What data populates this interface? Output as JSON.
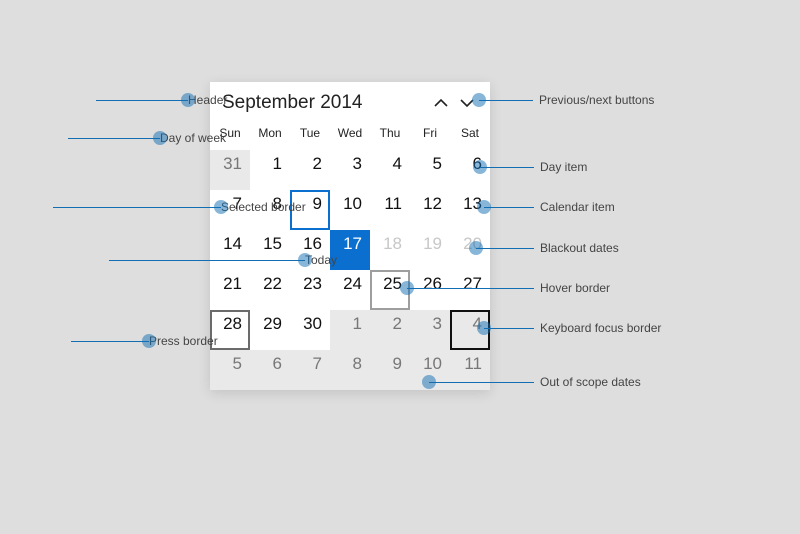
{
  "header": {
    "title": "September 2014"
  },
  "dow": [
    "Sun",
    "Mon",
    "Tue",
    "Wed",
    "Thu",
    "Fri",
    "Sat"
  ],
  "weeks": [
    [
      {
        "d": "31",
        "cls": "out"
      },
      {
        "d": "1"
      },
      {
        "d": "2"
      },
      {
        "d": "3"
      },
      {
        "d": "4"
      },
      {
        "d": "5"
      },
      {
        "d": "6"
      }
    ],
    [
      {
        "d": "7"
      },
      {
        "d": "8"
      },
      {
        "d": "9",
        "cls": "selected"
      },
      {
        "d": "10"
      },
      {
        "d": "11"
      },
      {
        "d": "12"
      },
      {
        "d": "13"
      }
    ],
    [
      {
        "d": "14"
      },
      {
        "d": "15"
      },
      {
        "d": "16"
      },
      {
        "d": "17",
        "cls": "today"
      },
      {
        "d": "18",
        "cls": "blackout"
      },
      {
        "d": "19",
        "cls": "blackout"
      },
      {
        "d": "20",
        "cls": "blackout"
      }
    ],
    [
      {
        "d": "21"
      },
      {
        "d": "22"
      },
      {
        "d": "23"
      },
      {
        "d": "24"
      },
      {
        "d": "25",
        "cls": "hover"
      },
      {
        "d": "26"
      },
      {
        "d": "27"
      }
    ],
    [
      {
        "d": "28",
        "cls": "press"
      },
      {
        "d": "29"
      },
      {
        "d": "30"
      },
      {
        "d": "1",
        "cls": "out"
      },
      {
        "d": "2",
        "cls": "out"
      },
      {
        "d": "3",
        "cls": "out"
      },
      {
        "d": "4",
        "cls": "out focus"
      }
    ],
    [
      {
        "d": "5",
        "cls": "out"
      },
      {
        "d": "6",
        "cls": "out"
      },
      {
        "d": "7",
        "cls": "out"
      },
      {
        "d": "8",
        "cls": "out"
      },
      {
        "d": "9",
        "cls": "out"
      },
      {
        "d": "10",
        "cls": "out"
      },
      {
        "d": "11",
        "cls": "out"
      }
    ]
  ],
  "legend": {
    "header": "Header",
    "dow": "Day of week",
    "selected": "Selected border",
    "today": "Today",
    "press": "Press border",
    "prevnext": "Previous/next buttons",
    "dayitem": "Day item",
    "calitem": "Calendar item",
    "blackout": "Blackout dates",
    "hover": "Hover border",
    "focus": "Keyboard focus border",
    "outofscope": "Out of scope dates"
  }
}
